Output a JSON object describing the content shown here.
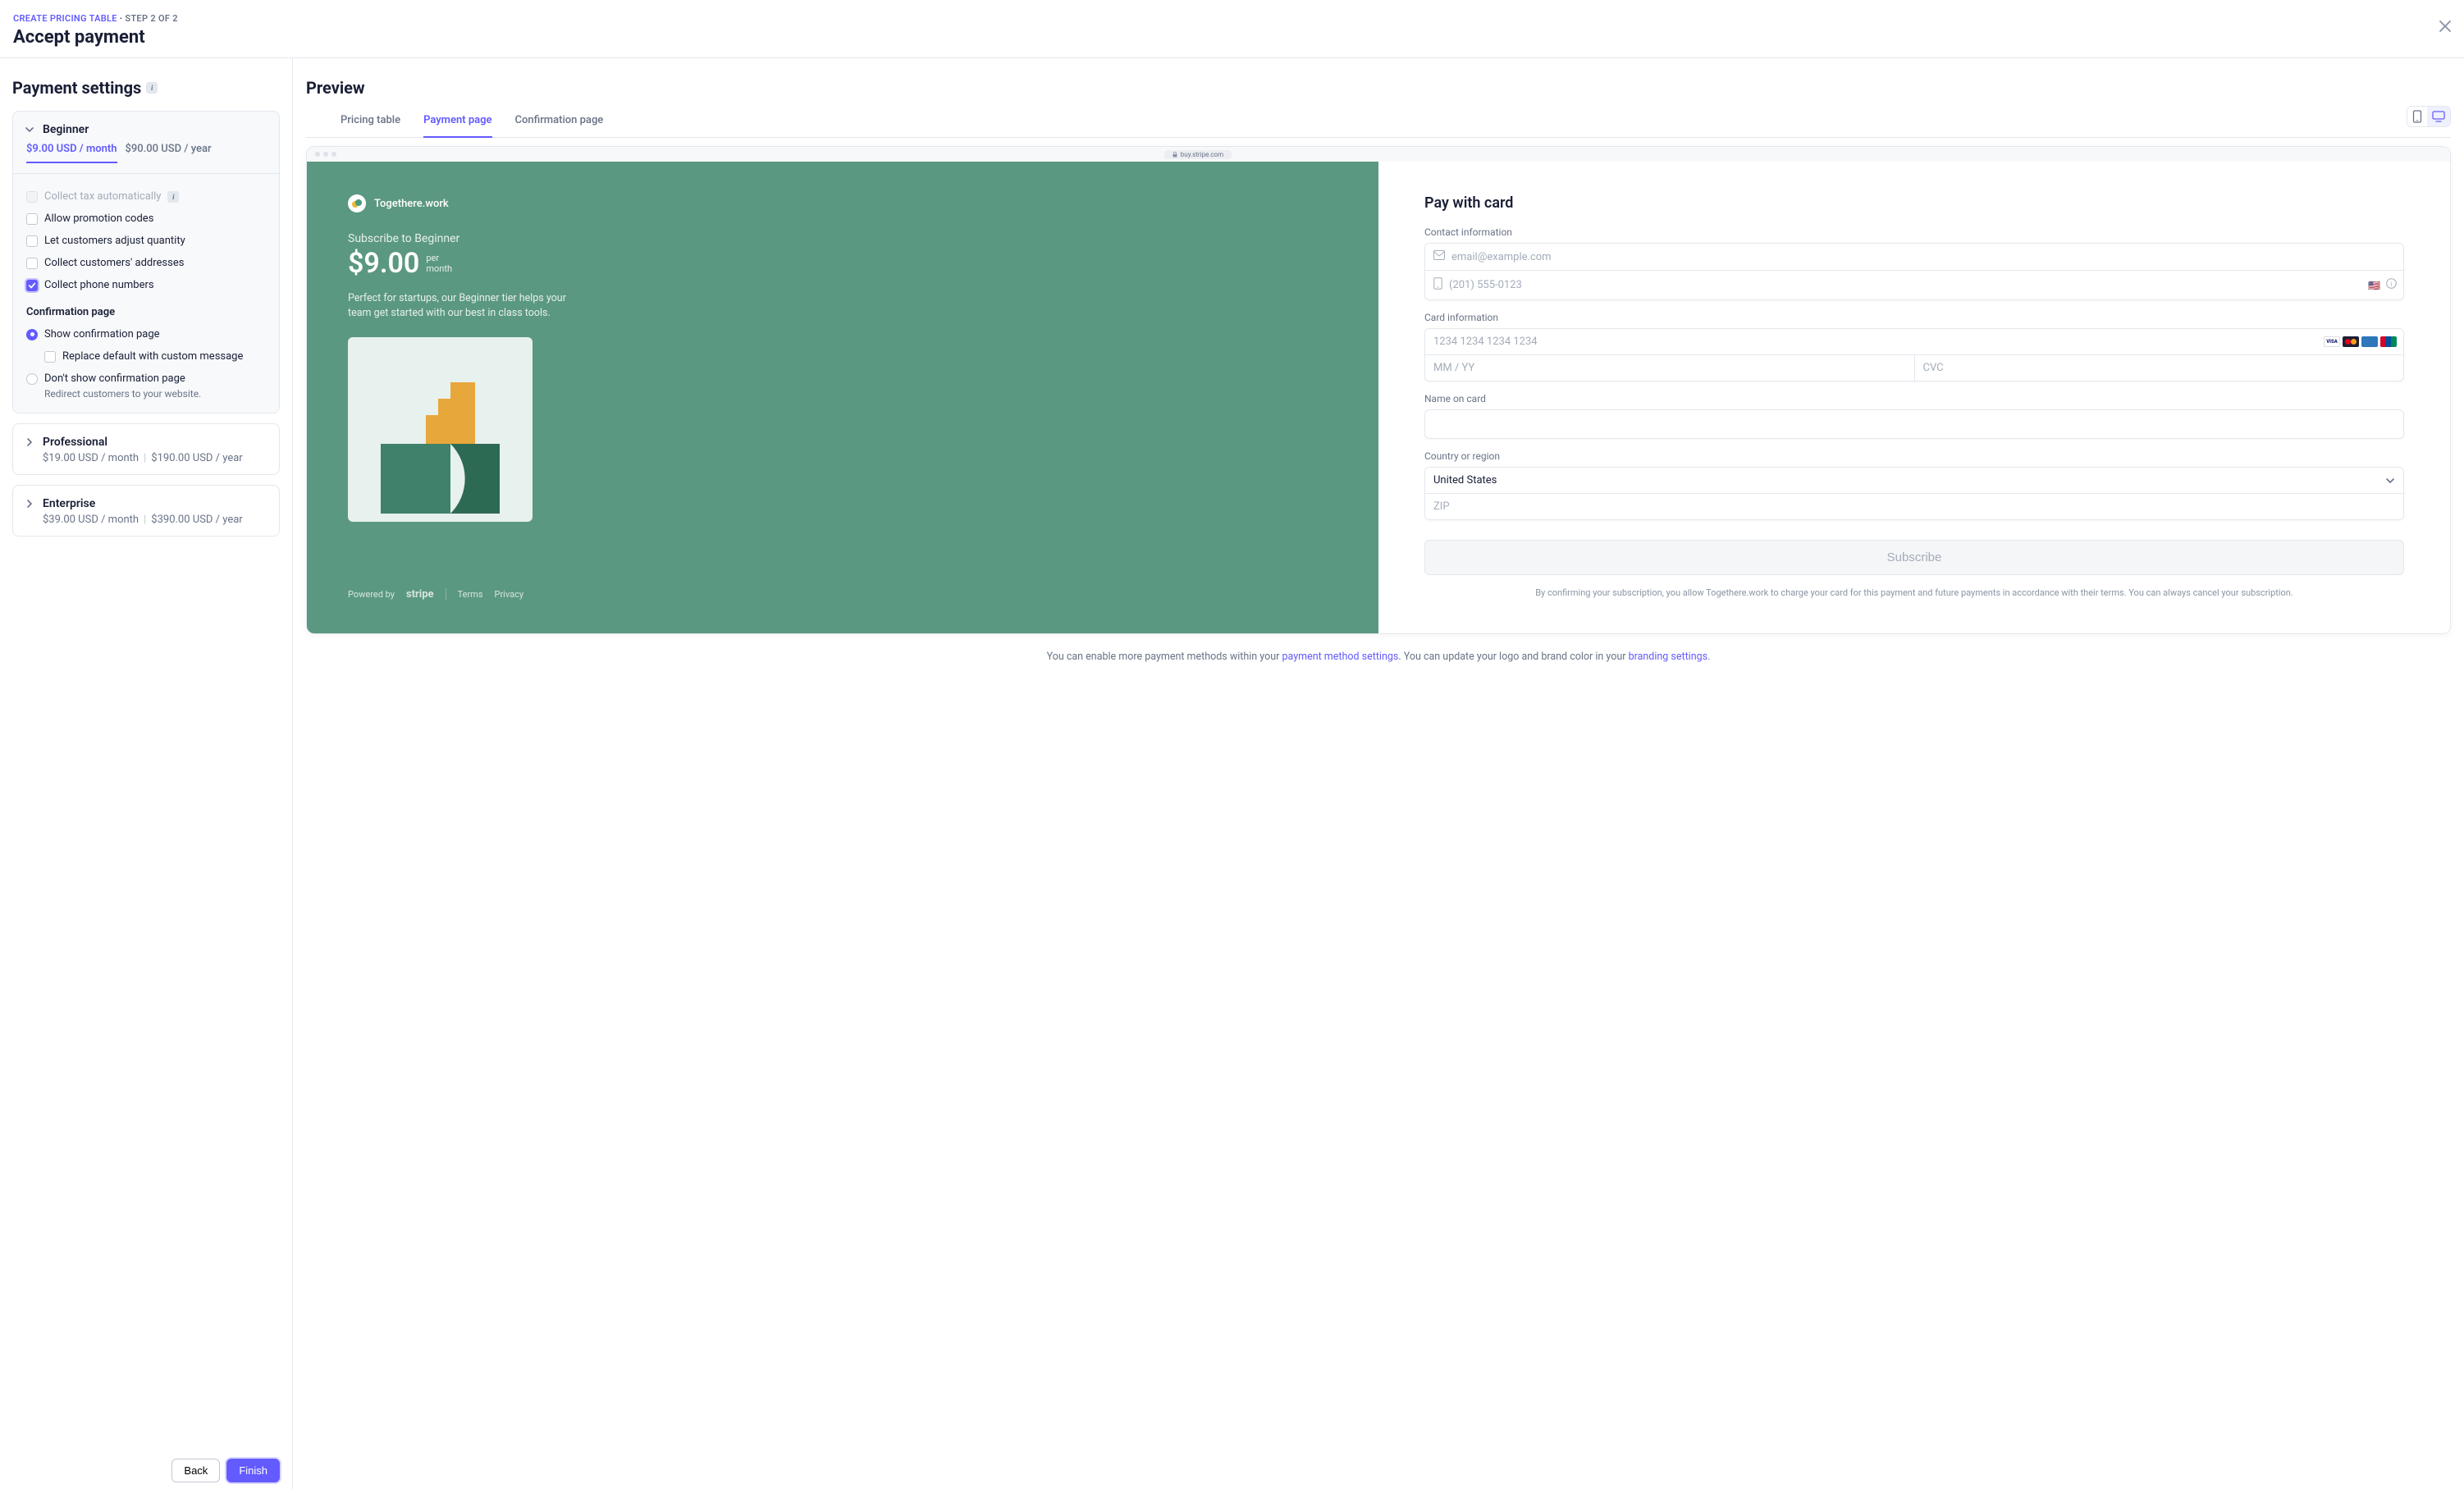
{
  "header": {
    "breadcrumb_link": "CREATE PRICING TABLE",
    "breadcrumb_sep": " · ",
    "breadcrumb_step": "STEP 2 OF 2",
    "title": "Accept payment"
  },
  "settings": {
    "heading": "Payment settings",
    "plans": {
      "beginner": {
        "name": "Beginner",
        "price_tabs": {
          "monthly": "$9.00 USD / month",
          "yearly": "$90.00 USD / year"
        },
        "checks": {
          "tax": "Collect tax automatically",
          "promo": "Allow promotion codes",
          "quantity": "Let customers adjust quantity",
          "addresses": "Collect customers' addresses",
          "phone": "Collect phone numbers"
        },
        "confirmation_heading": "Confirmation page",
        "radios": {
          "show": "Show confirmation page",
          "replace": "Replace default with custom message",
          "dont": "Don't show confirmation page",
          "dont_helper": "Redirect customers to your website."
        }
      },
      "professional": {
        "name": "Professional",
        "monthly": "$19.00 USD / month",
        "yearly": "$190.00 USD / year"
      },
      "enterprise": {
        "name": "Enterprise",
        "monthly": "$39.00 USD / month",
        "yearly": "$390.00 USD / year"
      }
    },
    "actions": {
      "back": "Back",
      "finish": "Finish"
    }
  },
  "preview": {
    "heading": "Preview",
    "tabs": {
      "pricing": "Pricing table",
      "payment": "Payment page",
      "confirmation": "Confirmation page"
    },
    "browser_url": "buy.stripe.com",
    "checkout": {
      "merchant": "Togethere.work",
      "subscribe_label": "Subscribe to Beginner",
      "price": "$9.00",
      "interval_top": "per",
      "interval_bottom": "month",
      "description": "Perfect for startups, our Beginner tier helps your team get started with our best in class tools.",
      "powered_by": "Powered by",
      "stripe": "stripe",
      "terms_link": "Terms",
      "privacy_link": "Privacy",
      "right": {
        "title": "Pay with card",
        "contact_label": "Contact information",
        "email_ph": "email@example.com",
        "phone_ph": "(201) 555-0123",
        "card_label": "Card information",
        "card_ph": "1234 1234 1234 1234",
        "exp_ph": "MM / YY",
        "cvc_ph": "CVC",
        "name_label": "Name on card",
        "country_label": "Country or region",
        "country_value": "United States",
        "zip_ph": "ZIP",
        "subscribe_btn": "Subscribe",
        "terms": "By confirming your subscription, you allow Togethere.work to charge your card for this payment and future payments in accordance with their terms. You can always cancel your subscription."
      }
    },
    "footer_note": {
      "part1": "You can enable more payment methods within your ",
      "link1": "payment method settings",
      "part2": ". You can update your logo and brand color in your ",
      "link2": "branding settings",
      "part3": "."
    }
  }
}
